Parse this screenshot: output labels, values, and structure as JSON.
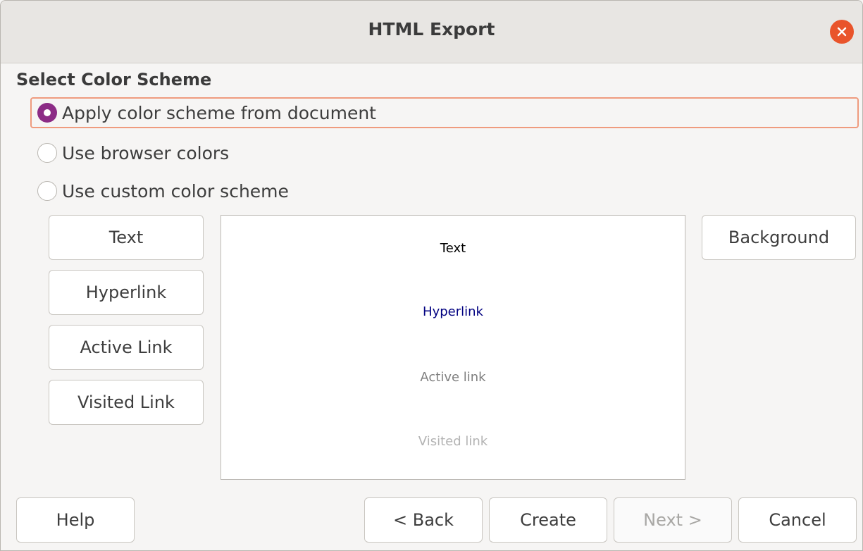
{
  "window": {
    "title": "HTML Export"
  },
  "icons": {
    "close": "close-icon"
  },
  "color_scheme": {
    "heading": "Select Color Scheme",
    "options": [
      {
        "label": "Apply color scheme from document",
        "selected": true
      },
      {
        "label": "Use browser colors",
        "selected": false
      },
      {
        "label": "Use custom color scheme",
        "selected": false
      }
    ]
  },
  "color_buttons": {
    "text": "Text",
    "hyperlink": "Hyperlink",
    "active_link": "Active Link",
    "visited_link": "Visited Link",
    "background": "Background"
  },
  "preview": {
    "text": "Text",
    "hyperlink": "Hyperlink",
    "active_link": "Active link",
    "visited_link": "Visited link",
    "colors": {
      "text": "#000000",
      "hyperlink": "#000080",
      "active_link": "#7f7f7f",
      "visited_link": "#b3b3b3",
      "background": "#ffffff"
    }
  },
  "footer": {
    "help": "Help",
    "back": "< Back",
    "create": "Create",
    "next": "Next >",
    "cancel": "Cancel",
    "next_enabled": false
  },
  "accent_colors": {
    "radio_selected": "#8c2c86",
    "focus_ring": "#ef9b7e",
    "close_button": "#e9542b"
  }
}
